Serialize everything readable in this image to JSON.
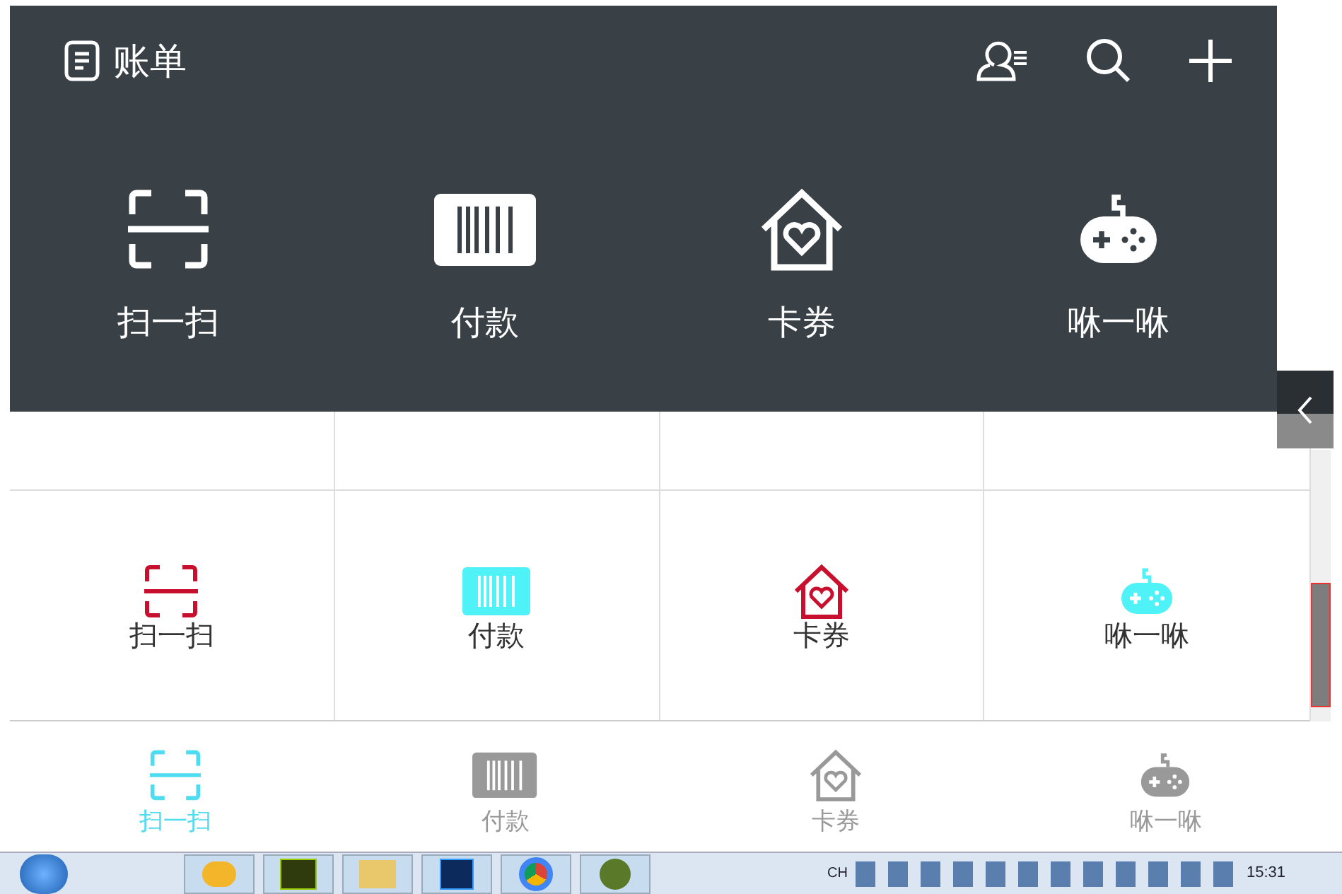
{
  "header": {
    "title": "账单",
    "actions": [
      {
        "kind": "user-list"
      },
      {
        "kind": "search"
      },
      {
        "kind": "plus"
      }
    ],
    "shortcuts": [
      {
        "kind": "scan",
        "label": "扫一扫"
      },
      {
        "kind": "barcode",
        "label": "付款"
      },
      {
        "kind": "house",
        "label": "卡券"
      },
      {
        "kind": "gamepad",
        "label": "咻一咻"
      }
    ]
  },
  "grid": [
    {
      "kind": "scan",
      "label": "扫一扫",
      "color": "#c8102e"
    },
    {
      "kind": "barcode",
      "label": "付款",
      "color": "#4ff2f7"
    },
    {
      "kind": "house",
      "label": "卡券",
      "color": "#c8102e"
    },
    {
      "kind": "gamepad",
      "label": "咻一咻",
      "color": "#4ff2f7"
    }
  ],
  "tab_bar": [
    {
      "kind": "scan",
      "label": "扫一扫",
      "selected": true
    },
    {
      "kind": "barcode",
      "label": "付款",
      "selected": false
    },
    {
      "kind": "house",
      "label": "卡券",
      "selected": false
    },
    {
      "kind": "gamepad",
      "label": "咻一咻",
      "selected": false
    }
  ],
  "taskbar": {
    "language": "CH",
    "time": "15:31"
  }
}
